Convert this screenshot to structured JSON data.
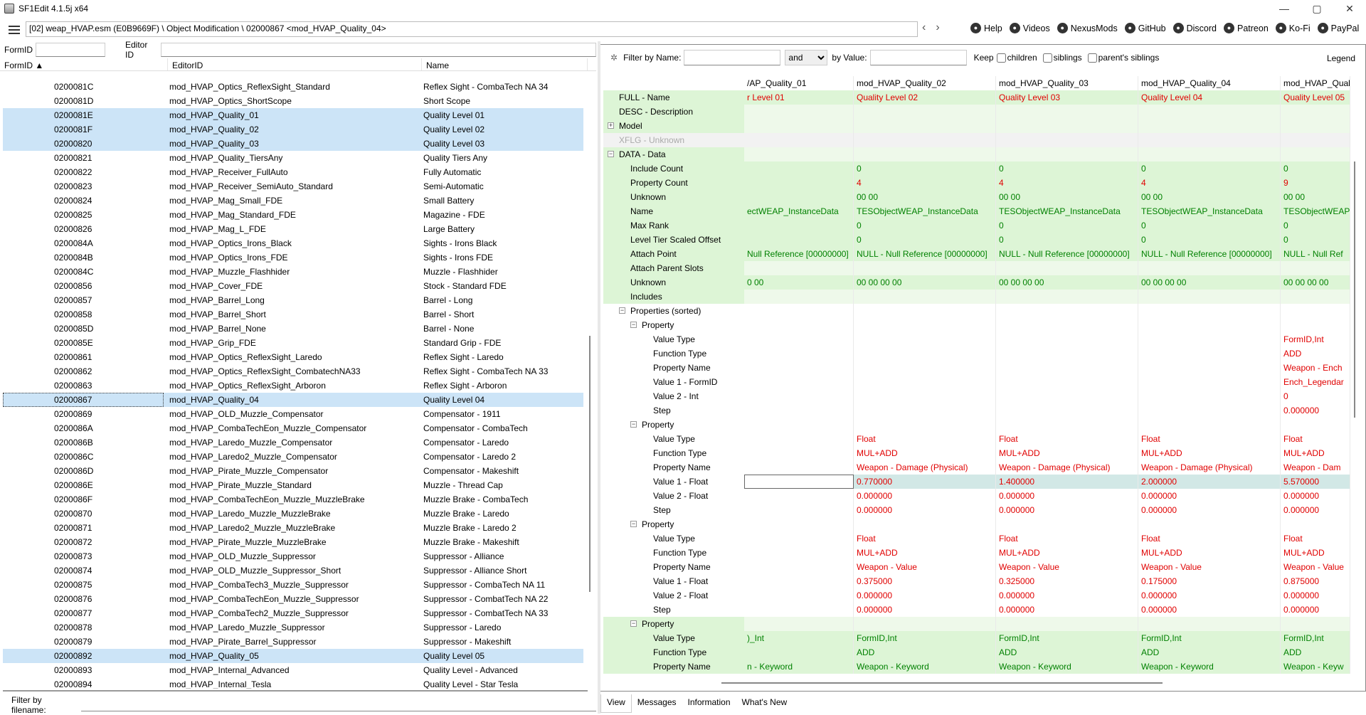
{
  "window": {
    "title": "SF1Edit 4.1.5j x64",
    "controls": [
      "—",
      "▢",
      "✕"
    ]
  },
  "toolbar": {
    "path": "[02] weap_HVAP.esm (E0B9669F) \\ Object Modification \\ 02000867 <mod_HVAP_Quality_04>",
    "back": "‹",
    "forward": "›",
    "links": [
      {
        "label": "Help",
        "icon": "book-icon"
      },
      {
        "label": "Videos",
        "icon": "video-icon"
      },
      {
        "label": "NexusMods",
        "icon": "nexus-icon"
      },
      {
        "label": "GitHub",
        "icon": "github-icon"
      },
      {
        "label": "Discord",
        "icon": "discord-icon"
      },
      {
        "label": "Patreon",
        "icon": "patreon-icon"
      },
      {
        "label": "Ko-Fi",
        "icon": "kofi-icon"
      },
      {
        "label": "PayPal",
        "icon": "paypal-icon"
      }
    ]
  },
  "left": {
    "formid_label": "FormID",
    "editorid_label": "Editor ID",
    "columns": [
      "FormID ▲",
      "EditorID",
      "Name"
    ],
    "rows": [
      {
        "formid": "0200081C",
        "editorid": "mod_HVAP_Optics_ReflexSight_Standard",
        "name": "Reflex Sight - CombaTech NA 34",
        "selected": false
      },
      {
        "formid": "0200081D",
        "editorid": "mod_HVAP_Optics_ShortScope",
        "name": "Short Scope",
        "selected": false
      },
      {
        "formid": "0200081E",
        "editorid": "mod_HVAP_Quality_01",
        "name": "Quality Level 01",
        "selected": true
      },
      {
        "formid": "0200081F",
        "editorid": "mod_HVAP_Quality_02",
        "name": "Quality Level 02",
        "selected": true
      },
      {
        "formid": "02000820",
        "editorid": "mod_HVAP_Quality_03",
        "name": "Quality Level 03",
        "selected": true
      },
      {
        "formid": "02000821",
        "editorid": "mod_HVAP_Quality_TiersAny",
        "name": "Quality Tiers Any",
        "selected": false
      },
      {
        "formid": "02000822",
        "editorid": "mod_HVAP_Receiver_FullAuto",
        "name": "Fully Automatic",
        "selected": false
      },
      {
        "formid": "02000823",
        "editorid": "mod_HVAP_Receiver_SemiAuto_Standard",
        "name": "Semi-Automatic",
        "selected": false
      },
      {
        "formid": "02000824",
        "editorid": "mod_HVAP_Mag_Small_FDE",
        "name": "Small Battery",
        "selected": false
      },
      {
        "formid": "02000825",
        "editorid": "mod_HVAP_Mag_Standard_FDE",
        "name": "Magazine - FDE",
        "selected": false
      },
      {
        "formid": "02000826",
        "editorid": "mod_HVAP_Mag_L_FDE",
        "name": "Large Battery",
        "selected": false
      },
      {
        "formid": "0200084A",
        "editorid": "mod_HVAP_Optics_Irons_Black",
        "name": "Sights - Irons Black",
        "selected": false
      },
      {
        "formid": "0200084B",
        "editorid": "mod_HVAP_Optics_Irons_FDE",
        "name": "Sights - Irons FDE",
        "selected": false
      },
      {
        "formid": "0200084C",
        "editorid": "mod_HVAP_Muzzle_Flashhider",
        "name": "Muzzle - Flashhider",
        "selected": false
      },
      {
        "formid": "02000856",
        "editorid": "mod_HVAP_Cover_FDE",
        "name": "Stock - Standard FDE",
        "selected": false
      },
      {
        "formid": "02000857",
        "editorid": "mod_HVAP_Barrel_Long",
        "name": "Barrel - Long",
        "selected": false
      },
      {
        "formid": "02000858",
        "editorid": "mod_HVAP_Barrel_Short",
        "name": "Barrel - Short",
        "selected": false
      },
      {
        "formid": "0200085D",
        "editorid": "mod_HVAP_Barrel_None",
        "name": "Barrel - None",
        "selected": false
      },
      {
        "formid": "0200085E",
        "editorid": "mod_HVAP_Grip_FDE",
        "name": "Standard Grip - FDE",
        "selected": false
      },
      {
        "formid": "02000861",
        "editorid": "mod_HVAP_Optics_ReflexSight_Laredo",
        "name": "Reflex Sight - Laredo",
        "selected": false
      },
      {
        "formid": "02000862",
        "editorid": "mod_HVAP_Optics_ReflexSight_CombatechNA33",
        "name": "Reflex Sight - CombaTech NA 33",
        "selected": false
      },
      {
        "formid": "02000863",
        "editorid": "mod_HVAP_Optics_ReflexSight_Arboron",
        "name": "Reflex Sight - Arboron",
        "selected": false
      },
      {
        "formid": "02000867",
        "editorid": "mod_HVAP_Quality_04",
        "name": "Quality Level 04",
        "selected": true,
        "focus": true
      },
      {
        "formid": "02000869",
        "editorid": "mod_HVAP_OLD_Muzzle_Compensator",
        "name": "Compensator - 1911",
        "selected": false
      },
      {
        "formid": "0200086A",
        "editorid": "mod_HVAP_CombaTechEon_Muzzle_Compensator",
        "name": "Compensator - CombaTech",
        "selected": false
      },
      {
        "formid": "0200086B",
        "editorid": "mod_HVAP_Laredo_Muzzle_Compensator",
        "name": "Compensator - Laredo",
        "selected": false
      },
      {
        "formid": "0200086C",
        "editorid": "mod_HVAP_Laredo2_Muzzle_Compensator",
        "name": "Compensator - Laredo 2",
        "selected": false
      },
      {
        "formid": "0200086D",
        "editorid": "mod_HVAP_Pirate_Muzzle_Compensator",
        "name": "Compensator - Makeshift",
        "selected": false
      },
      {
        "formid": "0200086E",
        "editorid": "mod_HVAP_Pirate_Muzzle_Standard",
        "name": "Muzzle - Thread Cap",
        "selected": false
      },
      {
        "formid": "0200086F",
        "editorid": "mod_HVAP_CombaTechEon_Muzzle_MuzzleBrake",
        "name": "Muzzle Brake - CombaTech",
        "selected": false
      },
      {
        "formid": "02000870",
        "editorid": "mod_HVAP_Laredo_Muzzle_MuzzleBrake",
        "name": "Muzzle Brake - Laredo",
        "selected": false
      },
      {
        "formid": "02000871",
        "editorid": "mod_HVAP_Laredo2_Muzzle_MuzzleBrake",
        "name": "Muzzle Brake - Laredo 2",
        "selected": false
      },
      {
        "formid": "02000872",
        "editorid": "mod_HVAP_Pirate_Muzzle_MuzzleBrake",
        "name": "Muzzle Brake - Makeshift",
        "selected": false
      },
      {
        "formid": "02000873",
        "editorid": "mod_HVAP_OLD_Muzzle_Suppressor",
        "name": "Suppressor - Alliance",
        "selected": false
      },
      {
        "formid": "02000874",
        "editorid": "mod_HVAP_OLD_Muzzle_Suppressor_Short",
        "name": "Suppressor - Alliance Short",
        "selected": false
      },
      {
        "formid": "02000875",
        "editorid": "mod_HVAP_CombaTech3_Muzzle_Suppressor",
        "name": "Suppressor - CombaTech NA 11",
        "selected": false
      },
      {
        "formid": "02000876",
        "editorid": "mod_HVAP_CombaTechEon_Muzzle_Suppressor",
        "name": "Suppressor - CombatTech NA 22",
        "selected": false
      },
      {
        "formid": "02000877",
        "editorid": "mod_HVAP_CombaTech2_Muzzle_Suppressor",
        "name": "Suppressor - CombatTech NA 33",
        "selected": false
      },
      {
        "formid": "02000878",
        "editorid": "mod_HVAP_Laredo_Muzzle_Suppressor",
        "name": "Suppressor - Laredo",
        "selected": false
      },
      {
        "formid": "02000879",
        "editorid": "mod_HVAP_Pirate_Barrel_Suppressor",
        "name": "Suppressor - Makeshift",
        "selected": false
      },
      {
        "formid": "02000892",
        "editorid": "mod_HVAP_Quality_05",
        "name": "Quality Level 05",
        "selected": true
      },
      {
        "formid": "02000893",
        "editorid": "mod_HVAP_Internal_Advanced",
        "name": "Quality Level - Advanced",
        "selected": false
      },
      {
        "formid": "02000894",
        "editorid": "mod_HVAP_Internal_Tesla",
        "name": "Quality Level - Star Tesla",
        "selected": false
      }
    ],
    "filename_label": "Filter by filename:"
  },
  "right": {
    "filter": {
      "pin": "✲",
      "by_name": "Filter by Name:",
      "op": "and",
      "by_value": "by Value:",
      "keep": "Keep",
      "children": "children",
      "siblings": "siblings",
      "parent_siblings": "parent's siblings",
      "legend": "Legend"
    },
    "headers": [
      "/AP_Quality_01",
      "mod_HVAP_Quality_02",
      "mod_HVAP_Quality_03",
      "mod_HVAP_Quality_04",
      "mod_HVAP_Quality_"
    ],
    "rows": [
      {
        "label": "FULL - Name",
        "indent": 0,
        "bg": "green",
        "color": "red",
        "cells": [
          "r Level 01",
          "Quality Level 02",
          "Quality Level 03",
          "Quality Level 04",
          "Quality Level 05"
        ]
      },
      {
        "label": "DESC - Description",
        "indent": 0,
        "bg": "lgreen",
        "color": "black",
        "cells": [
          "",
          "",
          "",
          "",
          ""
        ]
      },
      {
        "label": "Model",
        "indent": 0,
        "expander": "+",
        "bg": "lgreen",
        "color": "black",
        "cells": [
          "",
          "",
          "",
          "",
          ""
        ]
      },
      {
        "label": "XFLG - Unknown",
        "indent": 0,
        "bg": "gray",
        "color": "gray",
        "label_gray": true,
        "cells": [
          "",
          "",
          "",
          "",
          ""
        ]
      },
      {
        "label": "DATA - Data",
        "indent": 0,
        "expander": "−",
        "bg": "lgreen",
        "color": "black",
        "cells": [
          "",
          "",
          "",
          "",
          ""
        ]
      },
      {
        "label": "Include Count",
        "indent": 1,
        "bg": "green",
        "color": "green",
        "cells": [
          "",
          "0",
          "0",
          "0",
          "0"
        ]
      },
      {
        "label": "Property Count",
        "indent": 1,
        "bg": "green",
        "color": "red",
        "cells": [
          "",
          "4",
          "4",
          "4",
          "9"
        ]
      },
      {
        "label": "Unknown",
        "indent": 1,
        "bg": "green",
        "color": "green",
        "cells": [
          "",
          "00 00",
          "00 00",
          "00 00",
          "00 00"
        ]
      },
      {
        "label": "Name",
        "indent": 1,
        "bg": "green",
        "color": "green",
        "cells": [
          "ectWEAP_InstanceData",
          "TESObjectWEAP_InstanceData",
          "TESObjectWEAP_InstanceData",
          "TESObjectWEAP_InstanceData",
          "TESObjectWEAP"
        ]
      },
      {
        "label": "Max Rank",
        "indent": 1,
        "bg": "green",
        "color": "green",
        "cells": [
          "",
          "0",
          "0",
          "0",
          "0"
        ]
      },
      {
        "label": "Level Tier Scaled Offset",
        "indent": 1,
        "bg": "green",
        "color": "green",
        "cells": [
          "",
          "0",
          "0",
          "0",
          "0"
        ]
      },
      {
        "label": "Attach Point",
        "indent": 1,
        "bg": "green",
        "color": "green",
        "cells": [
          "Null Reference [00000000]",
          "NULL - Null Reference [00000000]",
          "NULL - Null Reference [00000000]",
          "NULL - Null Reference [00000000]",
          "NULL - Null Ref"
        ]
      },
      {
        "label": "Attach Parent Slots",
        "indent": 1,
        "bg": "lgreen",
        "color": "black",
        "cells": [
          "",
          "",
          "",
          "",
          ""
        ]
      },
      {
        "label": "Unknown",
        "indent": 1,
        "bg": "green",
        "color": "green",
        "cells": [
          "0 00",
          "00 00 00 00",
          "00 00 00 00",
          "00 00 00 00",
          "00 00 00 00"
        ]
      },
      {
        "label": "Includes",
        "indent": 1,
        "bg": "lgreen",
        "color": "black",
        "cells": [
          "",
          "",
          "",
          "",
          ""
        ]
      },
      {
        "label": "Properties (sorted)",
        "indent": 1,
        "expander": "−",
        "bg": "white",
        "color": "black",
        "cells": [
          "",
          "",
          "",
          "",
          ""
        ]
      },
      {
        "label": "Property",
        "indent": 2,
        "expander": "−",
        "bg": "white",
        "color": "black",
        "cells": [
          "",
          "",
          "",
          "",
          ""
        ]
      },
      {
        "label": "Value Type",
        "indent": 3,
        "bg": "white",
        "color": "red",
        "cells": [
          "",
          "",
          "",
          "",
          "FormID,Int"
        ]
      },
      {
        "label": "Function Type",
        "indent": 3,
        "bg": "white",
        "color": "red",
        "cells": [
          "",
          "",
          "",
          "",
          "ADD"
        ]
      },
      {
        "label": "Property Name",
        "indent": 3,
        "bg": "white",
        "color": "red",
        "cells": [
          "",
          "",
          "",
          "",
          "Weapon - Ench"
        ]
      },
      {
        "label": "Value 1 - FormID",
        "indent": 3,
        "bg": "white",
        "color": "red",
        "cells": [
          "",
          "",
          "",
          "",
          "Ench_Legendar"
        ]
      },
      {
        "label": "Value 2 - Int",
        "indent": 3,
        "bg": "white",
        "color": "red",
        "cells": [
          "",
          "",
          "",
          "",
          "0"
        ]
      },
      {
        "label": "Step",
        "indent": 3,
        "bg": "white",
        "color": "red",
        "cells": [
          "",
          "",
          "",
          "",
          "0.000000"
        ]
      },
      {
        "label": "Property",
        "indent": 2,
        "expander": "−",
        "bg": "white",
        "color": "black",
        "cells": [
          "",
          "",
          "",
          "",
          ""
        ]
      },
      {
        "label": "Value Type",
        "indent": 3,
        "bg": "white",
        "color": "red",
        "cells": [
          "",
          "Float",
          "Float",
          "Float",
          "Float"
        ]
      },
      {
        "label": "Function Type",
        "indent": 3,
        "bg": "white",
        "color": "red",
        "cells": [
          "",
          "MUL+ADD",
          "MUL+ADD",
          "MUL+ADD",
          "MUL+ADD"
        ]
      },
      {
        "label": "Property Name",
        "indent": 3,
        "bg": "white",
        "color": "red",
        "cells": [
          "",
          "Weapon - Damage (Physical)",
          "Weapon - Damage (Physical)",
          "Weapon - Damage (Physical)",
          "Weapon - Dam"
        ]
      },
      {
        "label": "Value 1 - Float",
        "indent": 3,
        "bg": "sel",
        "color": "red",
        "selected": true,
        "cells": [
          "",
          "0.770000",
          "1.400000",
          "2.000000",
          "5.570000"
        ]
      },
      {
        "label": "Value 2 - Float",
        "indent": 3,
        "bg": "white",
        "color": "red",
        "cells": [
          "",
          "0.000000",
          "0.000000",
          "0.000000",
          "0.000000"
        ]
      },
      {
        "label": "Step",
        "indent": 3,
        "bg": "white",
        "color": "red",
        "cells": [
          "",
          "0.000000",
          "0.000000",
          "0.000000",
          "0.000000"
        ]
      },
      {
        "label": "Property",
        "indent": 2,
        "expander": "−",
        "bg": "white",
        "color": "black",
        "cells": [
          "",
          "",
          "",
          "",
          ""
        ]
      },
      {
        "label": "Value Type",
        "indent": 3,
        "bg": "white",
        "color": "red",
        "cells": [
          "",
          "Float",
          "Float",
          "Float",
          "Float"
        ]
      },
      {
        "label": "Function Type",
        "indent": 3,
        "bg": "white",
        "color": "red",
        "cells": [
          "",
          "MUL+ADD",
          "MUL+ADD",
          "MUL+ADD",
          "MUL+ADD"
        ]
      },
      {
        "label": "Property Name",
        "indent": 3,
        "bg": "white",
        "color": "red",
        "cells": [
          "",
          "Weapon - Value",
          "Weapon - Value",
          "Weapon - Value",
          "Weapon - Value"
        ]
      },
      {
        "label": "Value 1 - Float",
        "indent": 3,
        "bg": "white",
        "color": "red",
        "cells": [
          "",
          "0.375000",
          "0.325000",
          "0.175000",
          "0.875000"
        ]
      },
      {
        "label": "Value 2 - Float",
        "indent": 3,
        "bg": "white",
        "color": "red",
        "cells": [
          "",
          "0.000000",
          "0.000000",
          "0.000000",
          "0.000000"
        ]
      },
      {
        "label": "Step",
        "indent": 3,
        "bg": "white",
        "color": "red",
        "cells": [
          "",
          "0.000000",
          "0.000000",
          "0.000000",
          "0.000000"
        ]
      },
      {
        "label": "Property",
        "indent": 2,
        "expander": "−",
        "bg": "lgreen",
        "color": "black",
        "cells": [
          "",
          "",
          "",
          "",
          ""
        ]
      },
      {
        "label": "Value Type",
        "indent": 3,
        "bg": "green",
        "color": "green",
        "cells": [
          ")_Int",
          "FormID,Int",
          "FormID,Int",
          "FormID,Int",
          "FormID,Int"
        ]
      },
      {
        "label": "Function Type",
        "indent": 3,
        "bg": "green",
        "color": "green",
        "cells": [
          "",
          "ADD",
          "ADD",
          "ADD",
          "ADD"
        ]
      },
      {
        "label": "Property Name",
        "indent": 3,
        "bg": "green",
        "color": "green",
        "cells": [
          "n - Keyword",
          "Weapon - Keyword",
          "Weapon - Keyword",
          "Weapon - Keyword",
          "Weapon - Keyw"
        ]
      }
    ]
  },
  "tabs": [
    {
      "label": "View",
      "active": true
    },
    {
      "label": "Messages",
      "active": false
    },
    {
      "label": "Information",
      "active": false
    },
    {
      "label": "What's New",
      "active": false
    }
  ]
}
